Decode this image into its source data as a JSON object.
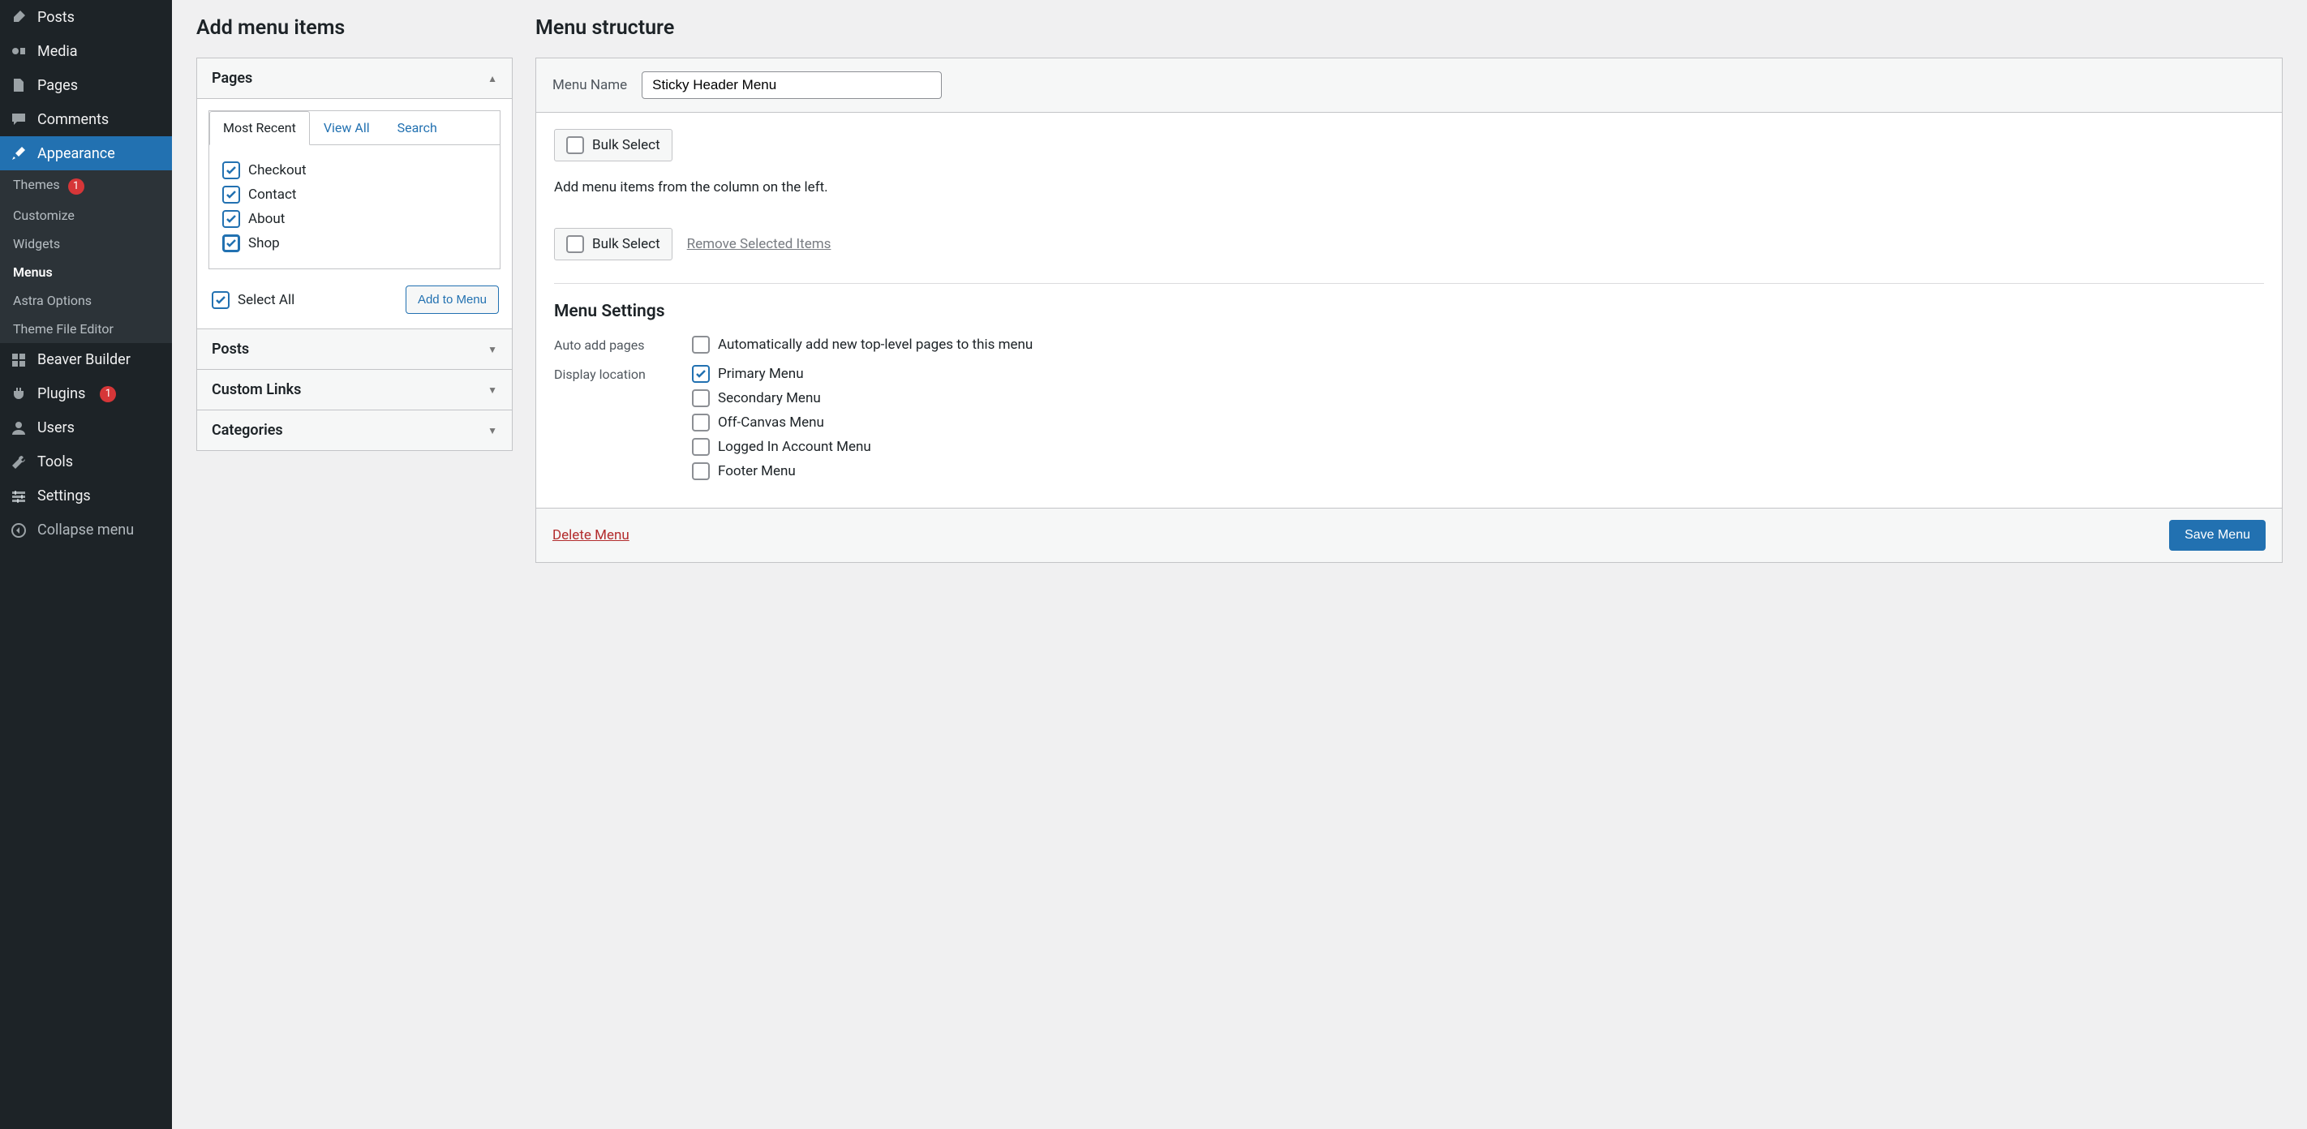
{
  "sidebar": {
    "items": [
      {
        "label": "Posts",
        "icon": "pin-icon"
      },
      {
        "label": "Media",
        "icon": "media-icon"
      },
      {
        "label": "Pages",
        "icon": "pages-icon"
      },
      {
        "label": "Comments",
        "icon": "comments-icon"
      },
      {
        "label": "Appearance",
        "icon": "brush-icon"
      },
      {
        "label": "Beaver Builder",
        "icon": "grid-icon"
      },
      {
        "label": "Plugins",
        "icon": "plug-icon",
        "badge": "1"
      },
      {
        "label": "Users",
        "icon": "user-icon"
      },
      {
        "label": "Tools",
        "icon": "wrench-icon"
      },
      {
        "label": "Settings",
        "icon": "settings-icon"
      },
      {
        "label": "Collapse menu",
        "icon": "collapse-icon"
      }
    ],
    "appearance_sub": [
      {
        "label": "Themes",
        "badge": "1"
      },
      {
        "label": "Customize"
      },
      {
        "label": "Widgets"
      },
      {
        "label": "Menus",
        "current": true
      },
      {
        "label": "Astra Options"
      },
      {
        "label": "Theme File Editor"
      }
    ]
  },
  "add_items": {
    "title": "Add menu items",
    "accordion": {
      "pages": "Pages",
      "posts": "Posts",
      "custom_links": "Custom Links",
      "categories": "Categories"
    },
    "tabs": {
      "most_recent": "Most Recent",
      "view_all": "View All",
      "search": "Search"
    },
    "pages_list": [
      "Checkout",
      "Contact",
      "About",
      "Shop"
    ],
    "select_all": "Select All",
    "add_to_menu": "Add to Menu"
  },
  "structure": {
    "title": "Menu structure",
    "menu_name_label": "Menu Name",
    "menu_name_value": "Sticky Header Menu",
    "bulk_select": "Bulk Select",
    "instruction": "Add menu items from the column on the left.",
    "remove_selected": "Remove Selected Items",
    "menu_settings": "Menu Settings",
    "auto_add_label": "Auto add pages",
    "auto_add_opt": "Automatically add new top-level pages to this menu",
    "display_loc_label": "Display location",
    "locations": [
      "Primary Menu",
      "Secondary Menu",
      "Off-Canvas Menu",
      "Logged In Account Menu",
      "Footer Menu"
    ],
    "delete_menu": "Delete Menu",
    "save_menu": "Save Menu"
  }
}
